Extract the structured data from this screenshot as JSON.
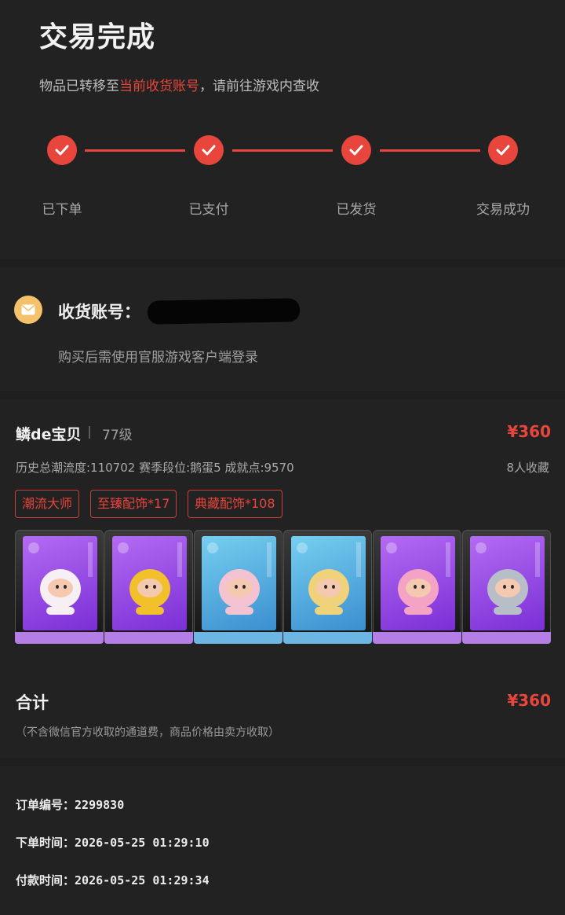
{
  "header": {
    "title": "交易完成",
    "subtitle_prefix": "物品已转移至",
    "subtitle_highlight": "当前收货账号",
    "subtitle_suffix": "，请前往游戏内查收"
  },
  "steps": [
    {
      "label": "已下单",
      "done": true
    },
    {
      "label": "已支付",
      "done": true
    },
    {
      "label": "已发货",
      "done": true
    },
    {
      "label": "交易成功",
      "done": true
    }
  ],
  "account": {
    "icon": "mail-icon",
    "label": "收货账号：",
    "note": "购买后需使用官服游戏客户端登录"
  },
  "item": {
    "seller_name": "鳞de宝贝",
    "level": "77级",
    "price": "¥360",
    "stats": "历史总潮流度:110702  赛季段位:鹅蛋5  成就点:9570",
    "favorites": "8人收藏",
    "tags": [
      "潮流大师",
      "至臻配饰*17",
      "典藏配饰*108"
    ],
    "cards": [
      {
        "name": "card-1",
        "bg": "purple",
        "color": "#f6f0f4"
      },
      {
        "name": "card-2",
        "bg": "purple",
        "color": "#f2c02a"
      },
      {
        "name": "card-3",
        "bg": "blue",
        "color": "#f4c3d2"
      },
      {
        "name": "card-4",
        "bg": "blue",
        "color": "#f0d27a"
      },
      {
        "name": "card-5",
        "bg": "purple",
        "color": "#f5a3c5"
      },
      {
        "name": "card-6",
        "bg": "purple",
        "color": "#b8bec8"
      }
    ]
  },
  "total": {
    "label": "合计",
    "price": "¥360",
    "note": "（不含微信官方收取的通道费，商品价格由卖方收取）"
  },
  "order": {
    "id_label": "订单编号：",
    "id_value": "2299830",
    "placed_label": "下单时间：",
    "placed_value": "2026-05-25 01:29:10",
    "paid_label": "付款时间：",
    "paid_value": "2026-05-25 01:29:34"
  },
  "colors": {
    "accent": "#e8453c",
    "background": "#1e1e1e",
    "panel": "#222222",
    "mail_icon": "#f3c26a"
  }
}
